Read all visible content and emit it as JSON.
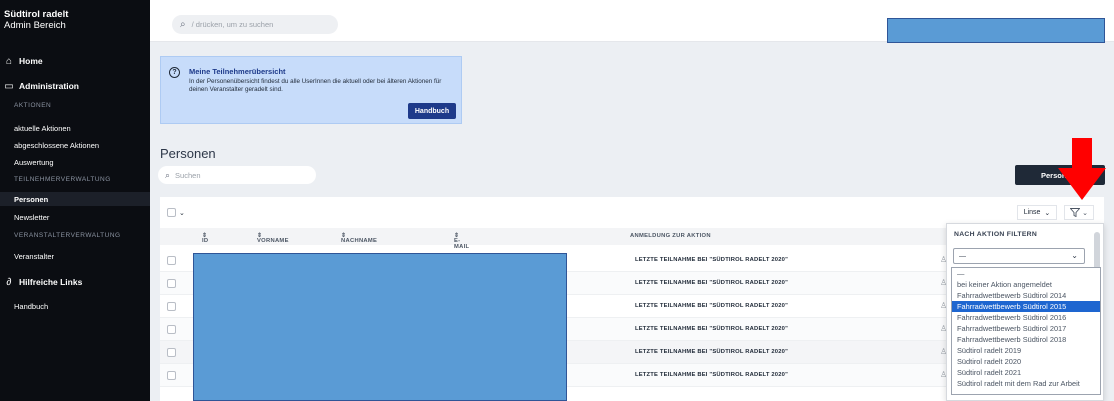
{
  "sidebar": {
    "brand_title": "Südtirol radelt",
    "brand_sub": "Admin Bereich",
    "home": "Home",
    "administration": "Administration",
    "sec_aktionen": "AKTIONEN",
    "items_aktionen": [
      "aktuelle Aktionen",
      "abgeschlossene Aktionen",
      "Auswertung"
    ],
    "sec_teilnehmer": "TEILNEHMERVERWALTUNG",
    "items_teilnehmer": [
      "Personen",
      "Newsletter"
    ],
    "sec_veranstalter": "VERANSTALTERVERWALTUNG",
    "items_veranstalter": [
      "Veranstalter"
    ],
    "hilfreiche_links": "Hilfreiche Links",
    "handbuch": "Handbuch"
  },
  "topbar": {
    "search_placeholder": "/ drücken, um zu suchen"
  },
  "info": {
    "title": "Meine Teilnehmerübersicht",
    "description": "In der Personenübersicht findest du alle UserInnen die aktuell oder bei älteren Aktionen für deinen Veranstalter geradelt sind.",
    "button": "Handbuch"
  },
  "page": {
    "title": "Personen",
    "search_placeholder": "Suchen",
    "create_button": "Person"
  },
  "table": {
    "lens_label": "Linse",
    "columns": [
      "ID",
      "VORNAME",
      "NACHNAME",
      "E-MAIL",
      "ANMELDUNG ZUR AKTION"
    ],
    "rows": [
      "LETZTE TEILNAHME BEI \"SÜDTIROL RADELT 2020\"",
      "LETZTE TEILNAHME BEI \"SÜDTIROL RADELT 2020\"",
      "LETZTE TEILNAHME BEI \"SÜDTIROL RADELT 2020\"",
      "LETZTE TEILNAHME BEI \"SÜDTIROL RADELT 2020\"",
      "LETZTE TEILNAHME BEI \"SÜDTIROL RADELT 2020\"",
      "LETZTE TEILNAHME BEI \"SÜDTIROL RADELT 2020\""
    ]
  },
  "filter": {
    "heading": "NACH AKTION FILTERN",
    "selected_value": "—",
    "options": [
      "—",
      "bei keiner Aktion angemeldet",
      "Fahrradwettbewerb Südtirol 2014",
      "Fahrradwettbewerb Südtirol 2015",
      "Fahrradwettbewerb Südtirol 2016",
      "Fahrradwettbewerb Südtirol 2017",
      "Fahrradwettbewerb Südtirol 2018",
      "Südtirol radelt 2019",
      "Südtirol radelt 2020",
      "Südtirol radelt 2021",
      "Südtirol radelt mit dem Rad zur Arbeit"
    ],
    "highlighted_option": "Fahrradwettbewerb Südtirol 2015"
  },
  "colors": {
    "sidebar": "#0b0d12",
    "info_bg": "#c7dcfa",
    "primary": "#1e3a8a",
    "highlight": "#1e66d0",
    "arrow": "#ff0000",
    "redaction": "#5a9bd5"
  }
}
